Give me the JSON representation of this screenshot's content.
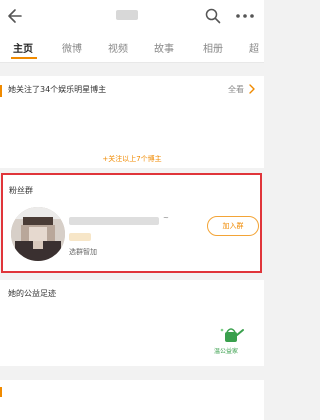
{
  "header": {
    "back_icon": "back-arrow-icon",
    "search_icon": "search-icon",
    "more_icon": "more-icon"
  },
  "tabs": [
    {
      "label": "主页",
      "active": true
    },
    {
      "label": "微博",
      "active": false
    },
    {
      "label": "视频",
      "active": false
    },
    {
      "label": "故事",
      "active": false
    },
    {
      "label": "相册",
      "active": false
    },
    {
      "label": "超",
      "active": false
    }
  ],
  "follow_section": {
    "title": "她关注了34个娱乐明星博主",
    "see_all": "全看",
    "followed_link": "+关注以上7个博主"
  },
  "fans_group": {
    "title": "粉丝群",
    "name_suffix": "~",
    "subtitle": "选群智加",
    "join_label": "加入群"
  },
  "charity": {
    "title": "她的公益足迹",
    "label": "温公益家"
  },
  "colors": {
    "accent": "#f08a00",
    "highlight_border": "#e0353a",
    "charity_green": "#3aa04d"
  }
}
